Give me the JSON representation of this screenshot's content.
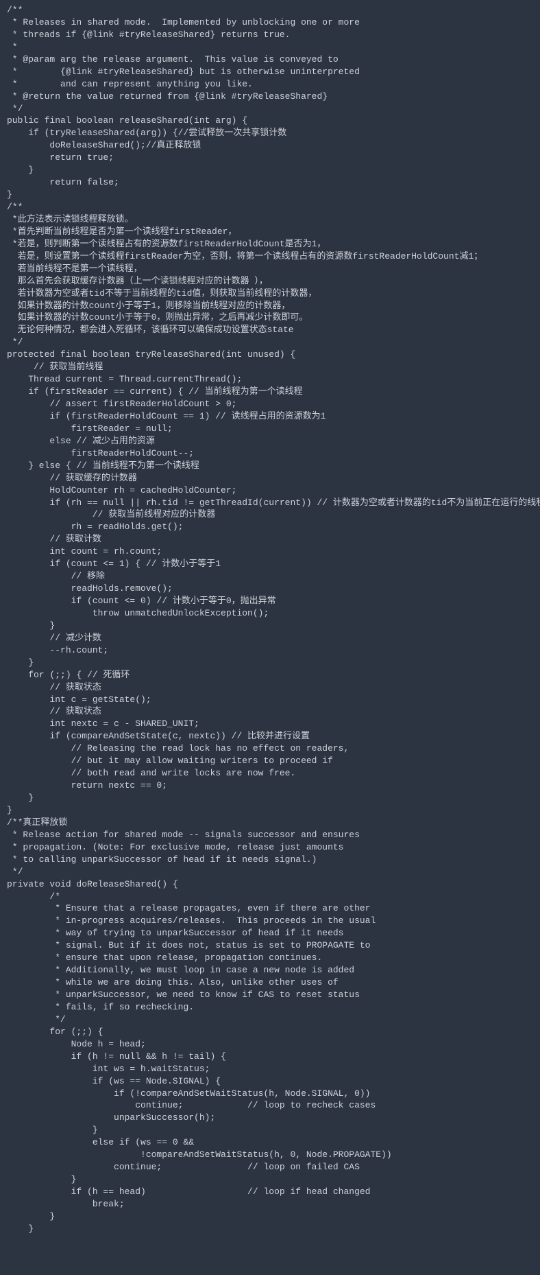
{
  "code": "/**\n * Releases in shared mode.  Implemented by unblocking one or more\n * threads if {@link #tryReleaseShared} returns true.\n *\n * @param arg the release argument.  This value is conveyed to\n *        {@link #tryReleaseShared} but is otherwise uninterpreted\n *        and can represent anything you like.\n * @return the value returned from {@link #tryReleaseShared}\n */\npublic final boolean releaseShared(int arg) {\n    if (tryReleaseShared(arg)) {//尝试释放一次共享锁计数\n        doReleaseShared();//真正释放锁\n        return true;\n    }\n        return false;\n}\n/**\n *此方法表示读锁线程释放锁。\n *首先判断当前线程是否为第一个读线程firstReader，\n *若是，则判断第一个读线程占有的资源数firstReaderHoldCount是否为1，\n  若是，则设置第一个读线程firstReader为空，否则，将第一个读线程占有的资源数firstReaderHoldCount减1；\n  若当前线程不是第一个读线程，\n  那么首先会获取缓存计数器（上一个读锁线程对应的计数器 ），\n  若计数器为空或者tid不等于当前线程的tid值，则获取当前线程的计数器，\n  如果计数器的计数count小于等于1，则移除当前线程对应的计数器，\n  如果计数器的计数count小于等于0，则抛出异常，之后再减少计数即可。\n  无论何种情况，都会进入死循环，该循环可以确保成功设置状态state\n */\nprotected final boolean tryReleaseShared(int unused) {\n     // 获取当前线程\n    Thread current = Thread.currentThread();\n    if (firstReader == current) { // 当前线程为第一个读线程\n        // assert firstReaderHoldCount > 0;\n        if (firstReaderHoldCount == 1) // 读线程占用的资源数为1\n            firstReader = null;\n        else // 减少占用的资源\n            firstReaderHoldCount--;\n    } else { // 当前线程不为第一个读线程\n        // 获取缓存的计数器\n        HoldCounter rh = cachedHoldCounter;\n        if (rh == null || rh.tid != getThreadId(current)) // 计数器为空或者计数器的tid不为当前正在运行的线程的tid\n                // 获取当前线程对应的计数器\n            rh = readHolds.get();\n        // 获取计数\n        int count = rh.count;\n        if (count <= 1) { // 计数小于等于1\n            // 移除\n            readHolds.remove();\n            if (count <= 0) // 计数小于等于0，抛出异常\n                throw unmatchedUnlockException();\n        }\n        // 减少计数\n        --rh.count;\n    }\n    for (;;) { // 死循环\n        // 获取状态\n        int c = getState();\n        // 获取状态\n        int nextc = c - SHARED_UNIT;\n        if (compareAndSetState(c, nextc)) // 比较并进行设置\n            // Releasing the read lock has no effect on readers,\n            // but it may allow waiting writers to proceed if\n            // both read and write locks are now free.\n            return nextc == 0;\n    }\n}\n/**真正释放锁\n * Release action for shared mode -- signals successor and ensures\n * propagation. (Note: For exclusive mode, release just amounts\n * to calling unparkSuccessor of head if it needs signal.)\n */\nprivate void doReleaseShared() {\n        /*\n         * Ensure that a release propagates, even if there are other\n         * in-progress acquires/releases.  This proceeds in the usual\n         * way of trying to unparkSuccessor of head if it needs\n         * signal. But if it does not, status is set to PROPAGATE to\n         * ensure that upon release, propagation continues.\n         * Additionally, we must loop in case a new node is added\n         * while we are doing this. Also, unlike other uses of\n         * unparkSuccessor, we need to know if CAS to reset status\n         * fails, if so rechecking.\n         */\n        for (;;) {\n            Node h = head;\n            if (h != null && h != tail) {\n                int ws = h.waitStatus;\n                if (ws == Node.SIGNAL) {\n                    if (!compareAndSetWaitStatus(h, Node.SIGNAL, 0))\n                        continue;            // loop to recheck cases\n                    unparkSuccessor(h);\n                }\n                else if (ws == 0 &&\n                         !compareAndSetWaitStatus(h, 0, Node.PROPAGATE))\n                    continue;                // loop on failed CAS\n            }\n            if (h == head)                   // loop if head changed\n                break;\n        }\n    }"
}
